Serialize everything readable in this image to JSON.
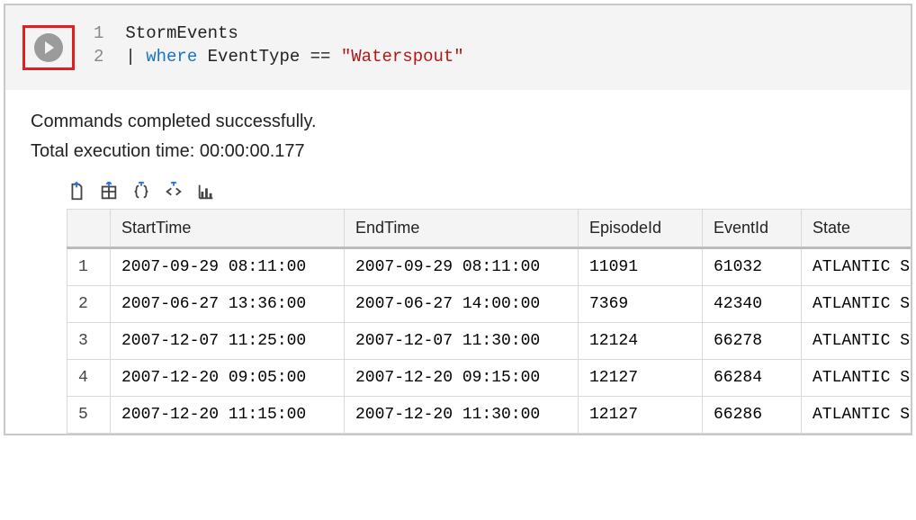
{
  "editor": {
    "lines": [
      {
        "num": "1",
        "tokens": [
          {
            "t": "plain",
            "v": "StormEvents"
          }
        ]
      },
      {
        "num": "2",
        "tokens": [
          {
            "t": "op",
            "v": "| "
          },
          {
            "t": "kw",
            "v": "where"
          },
          {
            "t": "plain",
            "v": " EventType "
          },
          {
            "t": "op",
            "v": "=="
          },
          {
            "t": "plain",
            "v": " "
          },
          {
            "t": "str",
            "v": "\"Waterspout\""
          }
        ]
      }
    ]
  },
  "status": {
    "message": "Commands completed successfully.",
    "time_label": "Total execution time: 00:00:00.177"
  },
  "toolbar_icons": [
    "export-file-icon",
    "export-table-icon",
    "export-json-icon",
    "export-code-icon",
    "chart-icon"
  ],
  "table": {
    "columns": [
      "StartTime",
      "EndTime",
      "EpisodeId",
      "EventId",
      "State"
    ],
    "rows": [
      {
        "n": "1",
        "StartTime": "2007-09-29 08:11:00",
        "EndTime": "2007-09-29 08:11:00",
        "EpisodeId": "11091",
        "EventId": "61032",
        "State": "ATLANTIC S"
      },
      {
        "n": "2",
        "StartTime": "2007-06-27 13:36:00",
        "EndTime": "2007-06-27 14:00:00",
        "EpisodeId": "7369",
        "EventId": "42340",
        "State": "ATLANTIC S"
      },
      {
        "n": "3",
        "StartTime": "2007-12-07 11:25:00",
        "EndTime": "2007-12-07 11:30:00",
        "EpisodeId": "12124",
        "EventId": "66278",
        "State": "ATLANTIC S"
      },
      {
        "n": "4",
        "StartTime": "2007-12-20 09:05:00",
        "EndTime": "2007-12-20 09:15:00",
        "EpisodeId": "12127",
        "EventId": "66284",
        "State": "ATLANTIC S"
      },
      {
        "n": "5",
        "StartTime": "2007-12-20 11:15:00",
        "EndTime": "2007-12-20 11:30:00",
        "EpisodeId": "12127",
        "EventId": "66286",
        "State": "ATLANTIC S"
      }
    ]
  }
}
